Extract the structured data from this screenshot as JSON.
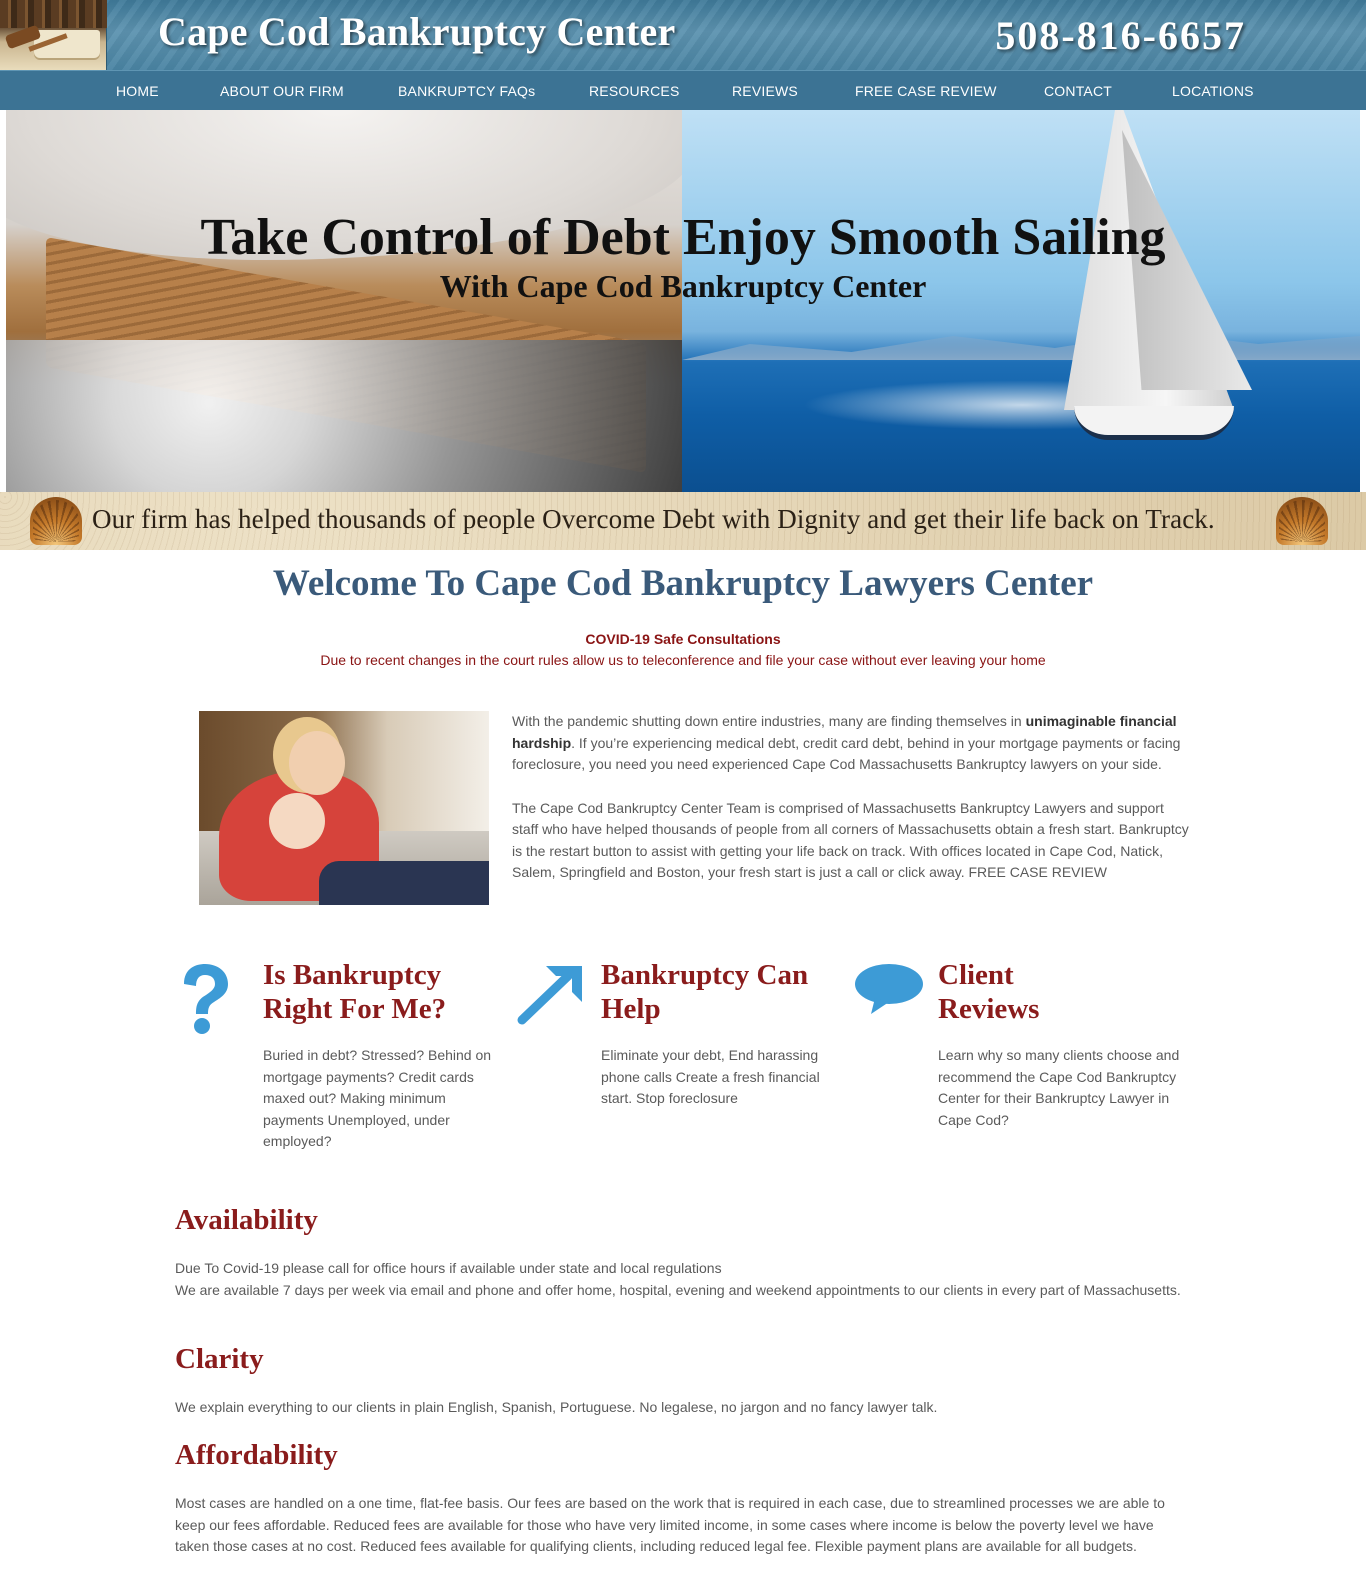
{
  "header": {
    "brand": "Cape Cod Bankruptcy Center",
    "phone": "508-816-6657"
  },
  "nav": {
    "items": [
      {
        "label": "HOME"
      },
      {
        "label": "ABOUT OUR FIRM"
      },
      {
        "label": "BANKRUPTCY FAQs"
      },
      {
        "label": "RESOURCES"
      },
      {
        "label": "REVIEWS"
      },
      {
        "label": "FREE CASE REVIEW"
      },
      {
        "label": "CONTACT"
      },
      {
        "label": "LOCATIONS"
      }
    ]
  },
  "hero": {
    "title": "Take Control of Debt Enjoy Smooth Sailing",
    "subtitle": "With Cape Cod Bankruptcy Center"
  },
  "banner": {
    "text": "Our firm has helped thousands of people Overcome Debt with Dignity and get their life back on Track."
  },
  "welcome": {
    "title": "Welcome To Cape Cod Bankruptcy Lawyers Center",
    "covid_title": "COVID-19 Safe Consultations",
    "covid_text": "Due to recent changes in the court rules allow us to teleconference and file your case without ever leaving your home"
  },
  "intro": {
    "p1_before": "With the pandemic shutting down entire industries, many are finding themselves in ",
    "p1_bold": "unimaginable financial hardship",
    "p1_after": ". If you’re experiencing medical debt, credit card debt, behind in your mortgage payments or facing foreclosure, you need you need experienced Cape Cod Massachusetts Bankruptcy lawyers on your side.",
    "p2": "The Cape Cod Bankruptcy Center Team is comprised of Massachusetts Bankruptcy Lawyers and support staff who have helped thousands of people from all corners of Massachusetts obtain a fresh start. Bankruptcy is the restart button to assist with getting your life back on track. With offices located in Cape Cod, Natick, Salem, Springfield and Boston, your fresh start is just a call or click away. FREE CASE REVIEW"
  },
  "features": [
    {
      "icon": "question-icon",
      "title_line1": "Is Bankruptcy",
      "title_line2": "Right For Me?",
      "text": "Buried in debt? Stressed? Behind on mortgage payments? Credit cards maxed out? Making minimum payments Unemployed, under employed?"
    },
    {
      "icon": "arrow-up-right-icon",
      "title_line1": "Bankruptcy Can",
      "title_line2": "Help",
      "text": "Eliminate your debt, End harassing phone calls Create a fresh financial start. Stop foreclosure"
    },
    {
      "icon": "speech-bubble-icon",
      "title_line1": "Client",
      "title_line2": "Reviews",
      "text": "Learn why so many clients choose and recommend the Cape Cod Bankruptcy Center for their Bankruptcy Lawyer in Cape Cod?"
    }
  ],
  "sections": {
    "availability": {
      "title": "Availability",
      "line1": "Due To Covid-19 please call for office hours if available under state and local regulations",
      "line2": "We are available 7 days per week via email and phone and offer home, hospital, evening and weekend appointments to our clients in every part of Massachusetts."
    },
    "clarity": {
      "title": "Clarity",
      "text": "We explain everything to our clients in plain English, Spanish, Portuguese. No legalese, no jargon and no fancy lawyer talk."
    },
    "affordability": {
      "title": "Affordability",
      "text": "Most cases are handled on a one time, flat-fee basis. Our fees are based on the work that is required in each case, due to streamlined processes we are able to keep our fees affordable. Reduced fees are available for those who have very limited income, in some cases where income is below the poverty level we have taken those cases at no cost. Reduced fees available for qualifying clients, including reduced legal fee. Flexible payment plans are available for all budgets."
    }
  },
  "colors": {
    "header_blue": "#4a84a3",
    "nav_blue": "#3c7394",
    "heading_red": "#8a1c1c",
    "welcome_blue": "#3a5a7a",
    "icon_blue": "#3d9bd6"
  }
}
